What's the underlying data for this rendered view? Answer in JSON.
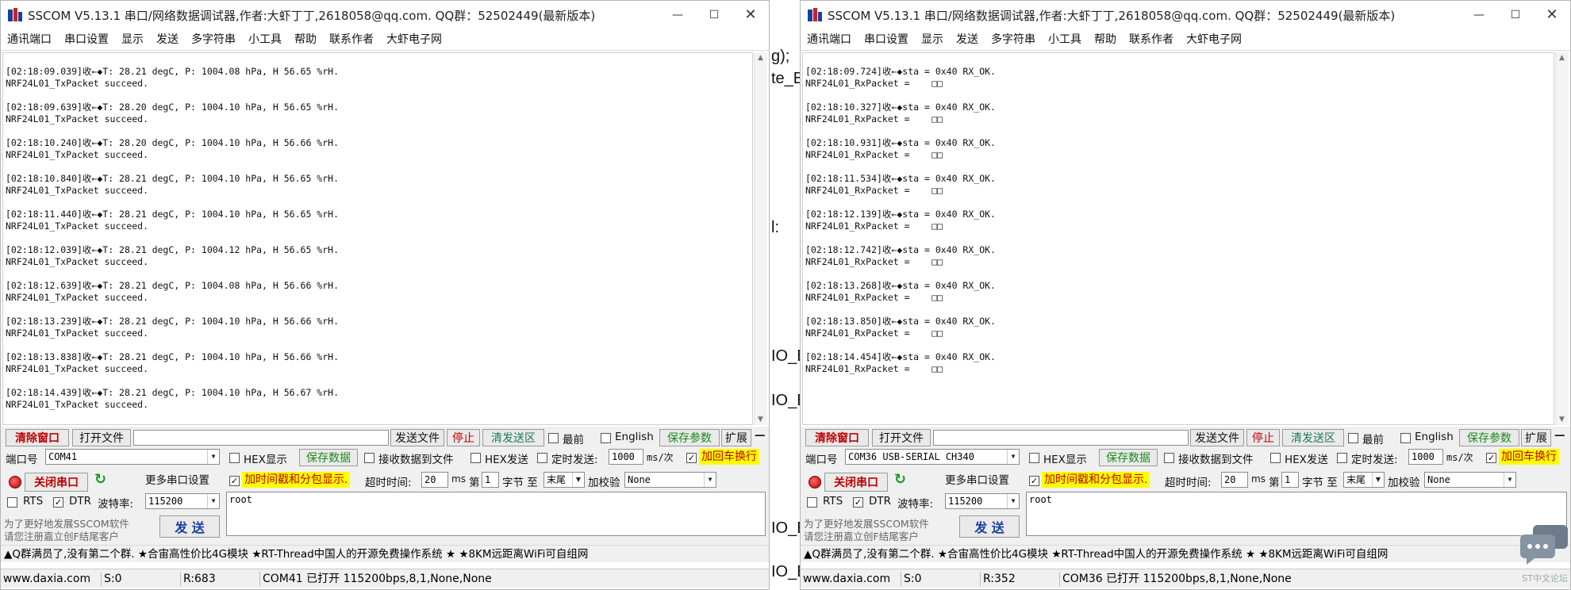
{
  "background_code": [
    "g);",
    "te_B",
    "l:",
    "IO_E",
    "IO_E",
    "IO_E",
    "IO_E"
  ],
  "left": {
    "title": "SSCOM V5.13.1 串口/网络数据调试器,作者:大虾丁丁,2618058@qq.com. QQ群：52502449(最新版本)",
    "menu": [
      "通讯端口",
      "串口设置",
      "显示",
      "发送",
      "多字符串",
      "小工具",
      "帮助",
      "联系作者",
      "大虾电子网"
    ],
    "entries": [
      {
        "line1": "[02:18:09.039]收←◆T: 28.21 degC, P: 1004.08 hPa, H 56.65 %rH.",
        "line2": "NRF24L01_TxPacket succeed."
      },
      {
        "line1": "[02:18:09.639]收←◆T: 28.20 degC, P: 1004.10 hPa, H 56.65 %rH.",
        "line2": "NRF24L01_TxPacket succeed."
      },
      {
        "line1": "[02:18:10.240]收←◆T: 28.20 degC, P: 1004.10 hPa, H 56.66 %rH.",
        "line2": "NRF24L01_TxPacket succeed."
      },
      {
        "line1": "[02:18:10.840]收←◆T: 28.21 degC, P: 1004.10 hPa, H 56.65 %rH.",
        "line2": "NRF24L01_TxPacket succeed."
      },
      {
        "line1": "[02:18:11.440]收←◆T: 28.21 degC, P: 1004.10 hPa, H 56.65 %rH.",
        "line2": "NRF24L01_TxPacket succeed."
      },
      {
        "line1": "[02:18:12.039]收←◆T: 28.21 degC, P: 1004.12 hPa, H 56.65 %rH.",
        "line2": "NRF24L01_TxPacket succeed."
      },
      {
        "line1": "[02:18:12.639]收←◆T: 28.21 degC, P: 1004.08 hPa, H 56.66 %rH.",
        "line2": "NRF24L01_TxPacket succeed."
      },
      {
        "line1": "[02:18:13.239]收←◆T: 28.21 degC, P: 1004.10 hPa, H 56.66 %rH.",
        "line2": "NRF24L01_TxPacket succeed."
      },
      {
        "line1": "[02:18:13.838]收←◆T: 28.21 degC, P: 1004.10 hPa, H 56.66 %rH.",
        "line2": "NRF24L01_TxPacket succeed."
      },
      {
        "line1": "[02:18:14.439]收←◆T: 28.21 degC, P: 1004.10 hPa, H 56.67 %rH.",
        "line2": "NRF24L01_TxPacket succeed."
      }
    ],
    "controls": {
      "clear_window": "清除窗口",
      "open_file": "打开文件",
      "send_file": "发送文件",
      "stop": "停止",
      "clear_send": "清发送区",
      "topmost": "最前",
      "english": "English",
      "save_params": "保存参数",
      "expand": "扩展",
      "port_label": "端口号",
      "port_value": "COM41",
      "more_settings": "更多串口设置",
      "close_port": "关闭串口",
      "hex_display": "HEX显示",
      "save_data": "保存数据",
      "recv_to_file": "接收数据到文件",
      "hex_send": "HEX发送",
      "timed_send": "定时发送:",
      "period": "1000",
      "period_unit": "ms/次",
      "add_crlf": "加回车换行",
      "timestamp": "加时间戳和分包显示.",
      "timeout_label": "超时时间:",
      "timeout_value": "20",
      "ms": "ms",
      "byte_prefix": "第",
      "byte_value": "1",
      "byte_label": "字节 至",
      "byte_end": "末尾",
      "checksum_label": "加校验",
      "checksum_value": "None",
      "rts": "RTS",
      "dtr": "DTR",
      "baud_label": "波特率:",
      "baud_value": "115200",
      "send_text": "root",
      "promo1": "为了更好地发展SSCOM软件",
      "promo2": "请您注册嘉立创F结尾客户",
      "send_button": "发 送"
    },
    "ad_text": "▲Q群满员了,没有第二个群. ★合宙高性价比4G模块 ★RT-Thread中国人的开源免费操作系统 ★ ★8KM远距离WiFi可自组网",
    "status": {
      "site": "www.daxia.com",
      "sent": "S:0",
      "recv": "R:683",
      "port_status": "COM41 已打开  115200bps,8,1,None,None"
    }
  },
  "right": {
    "title": "SSCOM V5.13.1 串口/网络数据调试器,作者:大虾丁丁,2618058@qq.com. QQ群：52502449(最新版本)",
    "menu": [
      "通讯端口",
      "串口设置",
      "显示",
      "发送",
      "多字符串",
      "小工具",
      "帮助",
      "联系作者",
      "大虾电子网"
    ],
    "entries": [
      {
        "line1": "[02:18:09.724]收←◆sta = 0x40 RX_OK.",
        "line2": "NRF24L01_RxPacket =    □□"
      },
      {
        "line1": "[02:18:10.327]收←◆sta = 0x40 RX_OK.",
        "line2": "NRF24L01_RxPacket =    □□"
      },
      {
        "line1": "[02:18:10.931]收←◆sta = 0x40 RX_OK.",
        "line2": "NRF24L01_RxPacket =    □□"
      },
      {
        "line1": "[02:18:11.534]收←◆sta = 0x40 RX_OK.",
        "line2": "NRF24L01_RxPacket =    □□"
      },
      {
        "line1": "[02:18:12.139]收←◆sta = 0x40 RX_OK.",
        "line2": "NRF24L01_RxPacket =    □□"
      },
      {
        "line1": "[02:18:12.742]收←◆sta = 0x40 RX_OK.",
        "line2": "NRF24L01_RxPacket =    □□"
      },
      {
        "line1": "[02:18:13.268]收←◆sta = 0x40 RX_OK.",
        "line2": "NRF24L01_RxPacket =    □□"
      },
      {
        "line1": "[02:18:13.850]收←◆sta = 0x40 RX_OK.",
        "line2": "NRF24L01_RxPacket =    □□"
      },
      {
        "line1": "[02:18:14.454]收←◆sta = 0x40 RX_OK.",
        "line2": "NRF24L01_RxPacket =    □□"
      }
    ],
    "controls": {
      "clear_window": "清除窗口",
      "open_file": "打开文件",
      "send_file": "发送文件",
      "stop": "停止",
      "clear_send": "清发送区",
      "topmost": "最前",
      "english": "English",
      "save_params": "保存参数",
      "expand": "扩展",
      "port_label": "端口号",
      "port_value": "COM36 USB-SERIAL CH340",
      "more_settings": "更多串口设置",
      "close_port": "关闭串口",
      "hex_display": "HEX显示",
      "save_data": "保存数据",
      "recv_to_file": "接收数据到文件",
      "hex_send": "HEX发送",
      "timed_send": "定时发送:",
      "period": "1000",
      "period_unit": "ms/次",
      "add_crlf": "加回车换行",
      "timestamp": "加时间戳和分包显示.",
      "timeout_label": "超时时间:",
      "timeout_value": "20",
      "ms": "ms",
      "byte_prefix": "第",
      "byte_value": "1",
      "byte_label": "字节 至",
      "byte_end": "末尾",
      "checksum_label": "加校验",
      "checksum_value": "None",
      "rts": "RTS",
      "dtr": "DTR",
      "baud_label": "波特率:",
      "baud_value": "115200",
      "send_text": "root",
      "promo1": "为了更好地发展SSCOM软件",
      "promo2": "请您注册嘉立创F结尾客户",
      "send_button": "发 送"
    },
    "ad_text": "▲Q群满员了,没有第二个群. ★合宙高性价比4G模块 ★RT-Thread中国人的开源免费操作系统 ★ ★8KM远距离WiFi可自组网",
    "status": {
      "site": "www.daxia.com",
      "sent": "S:0",
      "recv": "R:352",
      "port_status": "COM36 已打开  115200bps,8,1,None,None"
    }
  },
  "watermark": "ST中文论坛",
  "icons": {
    "app": "app-logo-icon",
    "minimize": "minimize-icon",
    "maximize": "maximize-icon",
    "close": "close-icon",
    "refresh": "refresh-icon",
    "lamp": "port-status-lamp-icon",
    "chat": "chat-bubble-icon"
  },
  "colors": {
    "red_button_text": "#c00000",
    "green_button_text": "#1a8a1a",
    "blue_link_text": "#1d3aa8",
    "highlight": "#ffff00"
  }
}
